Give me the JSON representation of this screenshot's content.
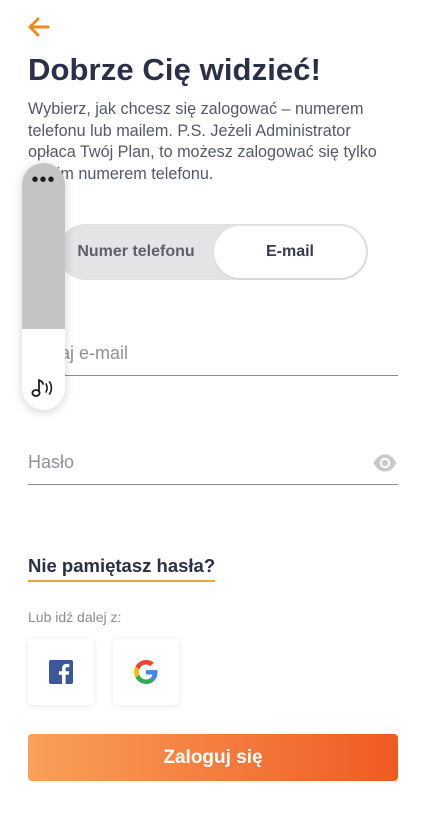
{
  "header": {
    "back_icon": "arrow-left-icon",
    "title": "Dobrze Cię widzieć!",
    "description": "Wybierz, jak chcesz się zalogować – numerem telefonu lub mailem. P.S. Jeżeli Administrator opłaca Twój Plan, to możesz zalogować się tylko swoim numerem telefonu."
  },
  "toggle": {
    "phone_label": "Numer telefonu",
    "email_label": "E-mail",
    "selected": "E-mail"
  },
  "form": {
    "email_placeholder": "Podaj e-mail",
    "password_placeholder": "Hasło",
    "eye_icon": "eye-icon"
  },
  "links": {
    "forgot_password": "Nie pamiętasz hasła?"
  },
  "social": {
    "label": "Lub idź dalej z:",
    "providers": [
      {
        "name": "facebook",
        "icon": "facebook-icon"
      },
      {
        "name": "google",
        "icon": "google-icon"
      }
    ]
  },
  "actions": {
    "login_label": "Zaloguj się"
  },
  "overlay": {
    "more_label": "•••",
    "audio_icon": "audio-note-icon"
  },
  "colors": {
    "accent": "#f47a3c",
    "back_arrow": "#ee8a1e",
    "title": "#2b2f47",
    "underline": "#f0a23a",
    "facebook": "#3b5998"
  }
}
